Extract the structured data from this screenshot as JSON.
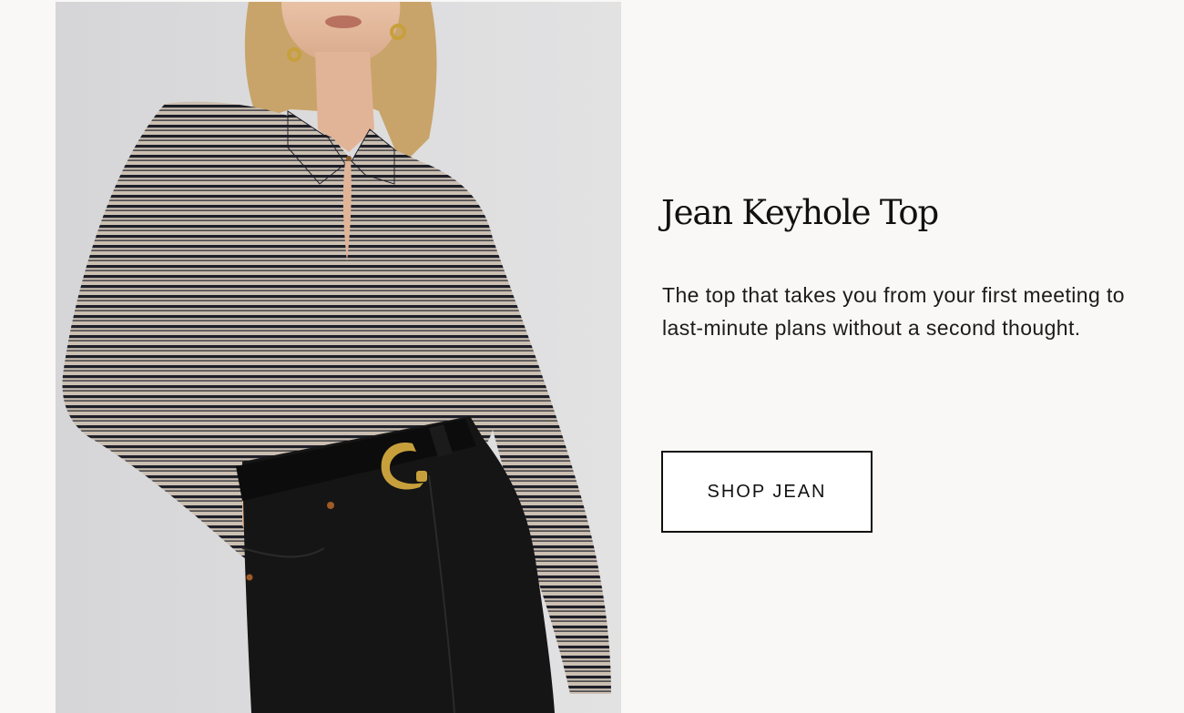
{
  "product": {
    "title": "Jean Keyhole Top",
    "description": "The top that takes you from your first meeting to last-minute plans without a second thought.",
    "cta_label": "SHOP JEAN"
  },
  "hero_image": {
    "subject": "model-in-striped-keyhole-top-and-black-jeans"
  },
  "colors": {
    "page_background": "#f9f8f6",
    "photo_background": "#dcdcdd",
    "text": "#111111",
    "stripe_light": "#cbbfb1",
    "stripe_dark": "#1d1f29",
    "denim": "#151515",
    "buckle": "#c7a03c"
  }
}
